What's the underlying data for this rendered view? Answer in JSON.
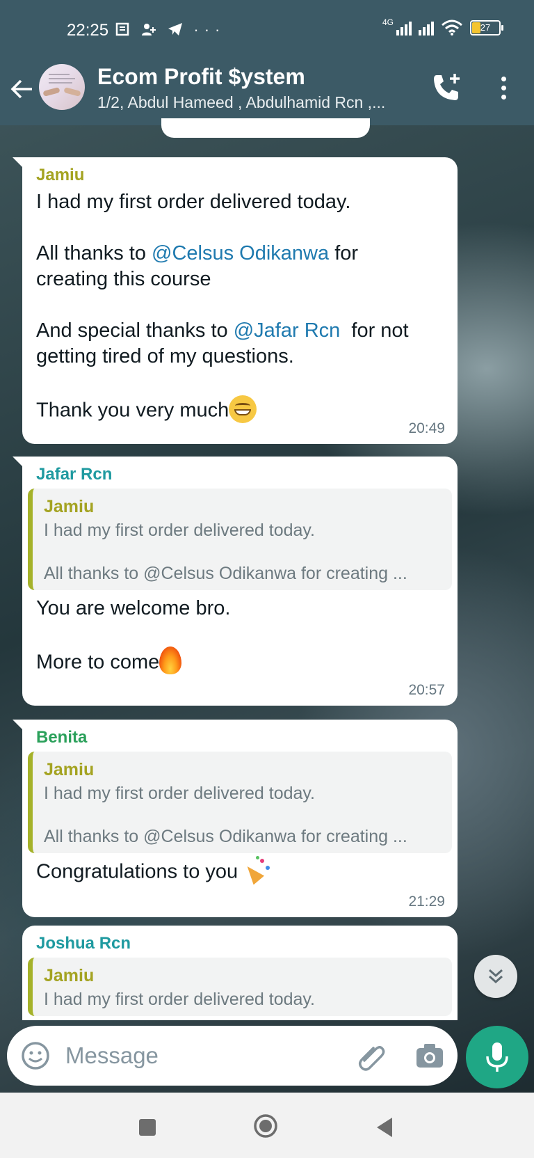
{
  "status": {
    "time": "22:25",
    "network": "4G",
    "battery": "27"
  },
  "header": {
    "title": "Ecom Profit $ystem",
    "subtitle": "1/2, Abdul Hameed , Abdulhamid Rcn ,..."
  },
  "colors": {
    "header_bg": "#3c5a66",
    "mention": "#1f7aaf",
    "sender_jamiu": "#a4a321",
    "sender_jafar": "#1f9aa0",
    "sender_benita": "#2aa05a",
    "sender_joshua": "#1f9aa0",
    "mic_bg": "#1fa785"
  },
  "messages": [
    {
      "sender": "Jamiu",
      "line1": "I had my first order delivered today.",
      "line2a": "All thanks to ",
      "mention1": "@Celsus Odikanwa",
      "line2b": " for",
      "line3": "creating this course",
      "line4a": "And special thanks to ",
      "mention2": "@Jafar Rcn",
      "line4b": "  for not",
      "line5": "getting tired of my questions.",
      "line6": "Thank you very much",
      "emoji": "grinning-face",
      "time": "20:49"
    },
    {
      "sender": "Jafar Rcn",
      "quote_sender": "Jamiu",
      "quote_line1": "I had my first order delivered today.",
      "quote_line2": "All thanks to @Celsus Odikanwa for creating ...",
      "line1": "You are welcome bro.",
      "line2": "More to come",
      "emoji": "fire",
      "time": "20:57"
    },
    {
      "sender": "Benita",
      "quote_sender": "Jamiu",
      "quote_line1": "I had my first order delivered today.",
      "quote_line2": "All thanks to @Celsus Odikanwa for creating ...",
      "line1": "Congratulations to you ",
      "emoji": "party-popper",
      "time": "21:29"
    },
    {
      "sender": "Joshua Rcn",
      "quote_sender": "Jamiu",
      "quote_line1": "I had my first order delivered today."
    }
  ],
  "composer": {
    "placeholder": "Message"
  }
}
